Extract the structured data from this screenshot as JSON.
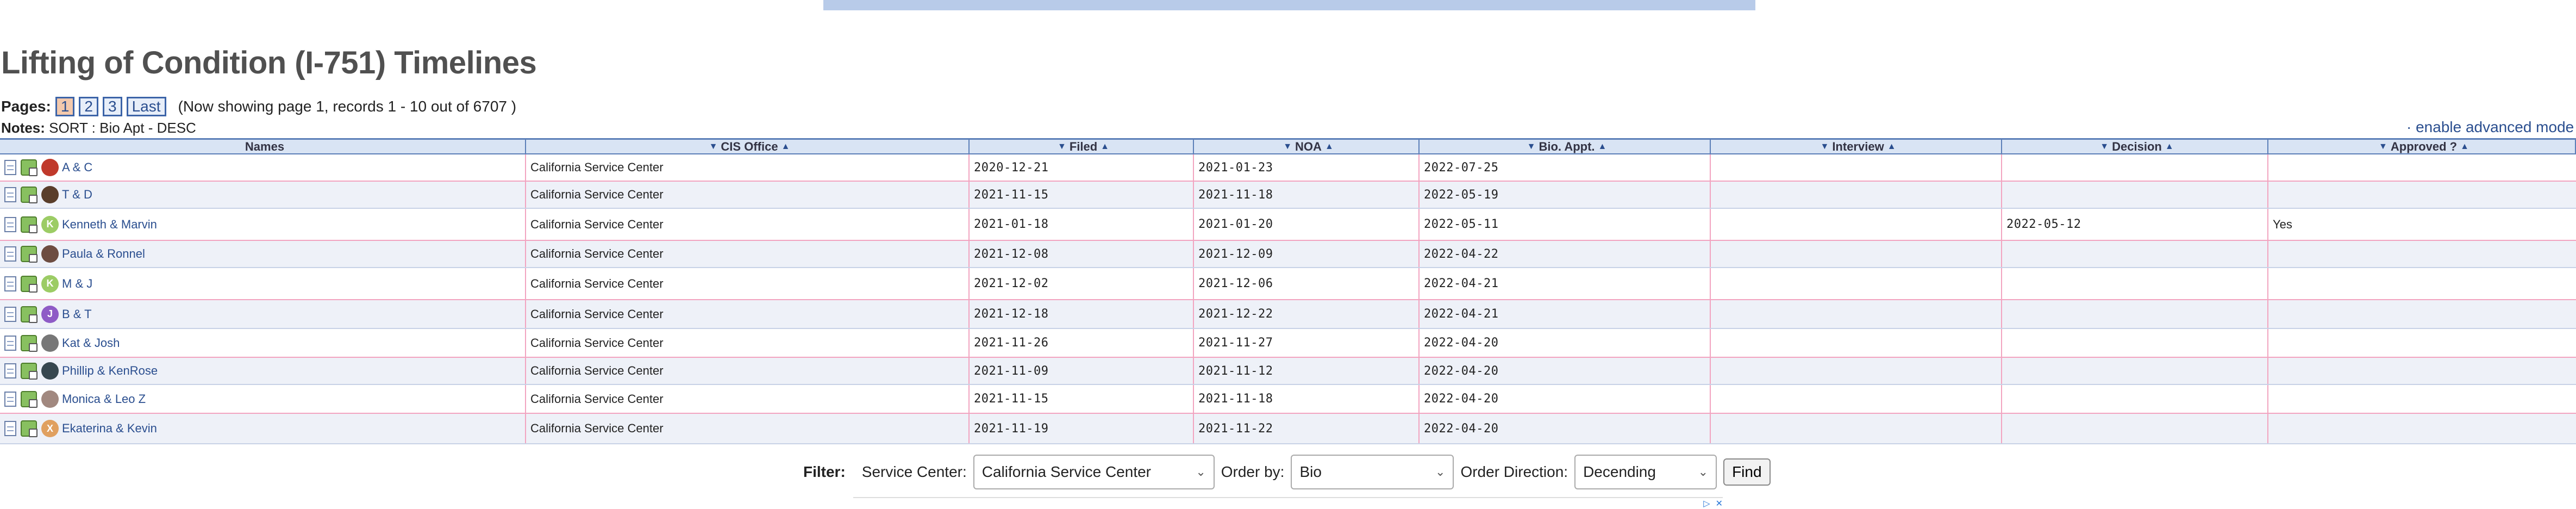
{
  "title": "Lifting of Condition (I-751) Timelines",
  "pagination": {
    "label": "Pages:",
    "pages": [
      "1",
      "2",
      "3"
    ],
    "last_label": "Last",
    "summary": "(Now showing page 1, records 1 - 10 out of 6707 )"
  },
  "notes": {
    "label": "Notes:",
    "text": "SORT : Bio Apt - DESC"
  },
  "advanced_mode_label": "· enable advanced mode",
  "columns": [
    "Names",
    "CIS Office",
    "Filed",
    "NOA",
    "Bio. Appt.",
    "Interview",
    "Decision",
    "Approved ?"
  ],
  "rows": [
    {
      "names": "A & C",
      "office": "California Service Center",
      "filed": "2020-12-21",
      "noa": "2021-01-23",
      "bio": "2022-07-25",
      "interview": "",
      "decision": "",
      "approved": "",
      "avatar": {
        "letter": "",
        "color": "#c0392b"
      }
    },
    {
      "names": "T & D",
      "office": "California Service Center",
      "filed": "2021-11-15",
      "noa": "2021-11-18",
      "bio": "2022-05-19",
      "interview": "",
      "decision": "",
      "approved": "",
      "avatar": {
        "letter": "",
        "color": "#5a3e2b"
      }
    },
    {
      "names": "Kenneth & Marvin",
      "office": "California Service Center",
      "filed": "2021-01-18",
      "noa": "2021-01-20",
      "bio": "2022-05-11",
      "interview": "",
      "decision": "2022-05-12",
      "approved": "Yes",
      "avatar": {
        "letter": "K",
        "color": "#9ccc65"
      }
    },
    {
      "names": "Paula & Ronnel",
      "office": "California Service Center",
      "filed": "2021-12-08",
      "noa": "2021-12-09",
      "bio": "2022-04-22",
      "interview": "",
      "decision": "",
      "approved": "",
      "avatar": {
        "letter": "",
        "color": "#6d4c41"
      }
    },
    {
      "names": "M & J",
      "office": "California Service Center",
      "filed": "2021-12-02",
      "noa": "2021-12-06",
      "bio": "2022-04-21",
      "interview": "",
      "decision": "",
      "approved": "",
      "avatar": {
        "letter": "K",
        "color": "#9ccc65"
      }
    },
    {
      "names": "B & T",
      "office": "California Service Center",
      "filed": "2021-12-18",
      "noa": "2021-12-22",
      "bio": "2022-04-21",
      "interview": "",
      "decision": "",
      "approved": "",
      "avatar": {
        "letter": "J",
        "color": "#8e5bc6"
      }
    },
    {
      "names": "Kat & Josh",
      "office": "California Service Center",
      "filed": "2021-11-26",
      "noa": "2021-11-27",
      "bio": "2022-04-20",
      "interview": "",
      "decision": "",
      "approved": "",
      "avatar": {
        "letter": "",
        "color": "#777777"
      }
    },
    {
      "names": "Phillip & KenRose",
      "office": "California Service Center",
      "filed": "2021-11-09",
      "noa": "2021-11-12",
      "bio": "2022-04-20",
      "interview": "",
      "decision": "",
      "approved": "",
      "avatar": {
        "letter": "",
        "color": "#37474f"
      }
    },
    {
      "names": "Monica & Leo Z",
      "office": "California Service Center",
      "filed": "2021-11-15",
      "noa": "2021-11-18",
      "bio": "2022-04-20",
      "interview": "",
      "decision": "",
      "approved": "",
      "avatar": {
        "letter": "",
        "color": "#a1887f"
      }
    },
    {
      "names": "Ekaterina & Kevin",
      "office": "California Service Center",
      "filed": "2021-11-19",
      "noa": "2021-11-22",
      "bio": "2022-04-20",
      "interview": "",
      "decision": "",
      "approved": "",
      "avatar": {
        "letter": "X",
        "color": "#e0a060"
      }
    }
  ],
  "filter": {
    "label": "Filter:",
    "service_center_label": "Service Center:",
    "service_center_value": "California Service Center",
    "order_by_label": "Order by:",
    "order_by_value": "Bio",
    "direction_label": "Order Direction:",
    "direction_value": "Decending",
    "find_label": "Find"
  },
  "ad": {
    "close_label": "✕"
  },
  "colors": {
    "accent": "#2a4e8f",
    "header_bg": "#d9e4f4",
    "row_alt": "#eef1f8",
    "row_divider": "#f2a4c0"
  }
}
